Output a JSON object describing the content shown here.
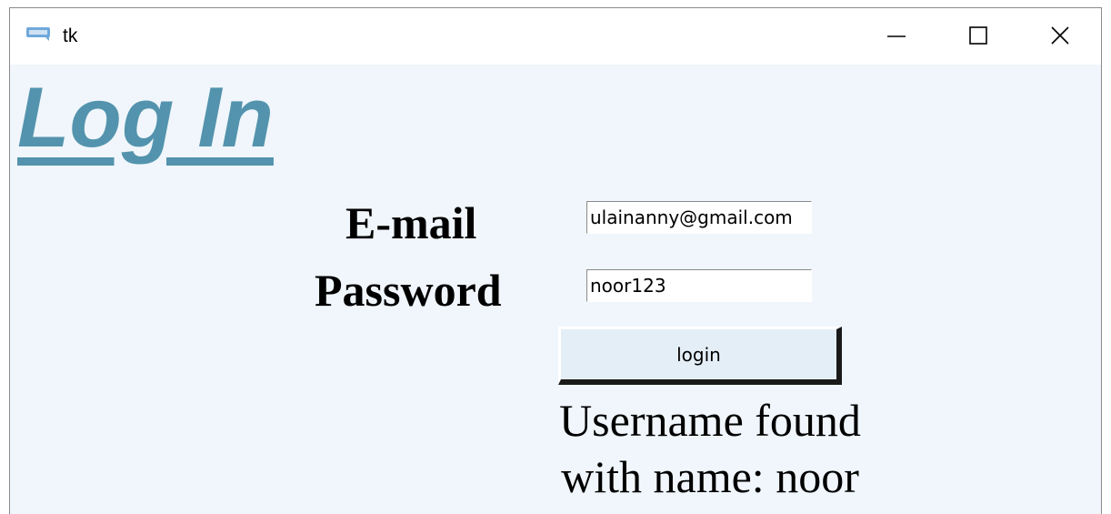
{
  "window": {
    "title": "tk",
    "icon": "login-app-icon",
    "controls": [
      "minimize-icon",
      "maximize-icon",
      "close-icon"
    ]
  },
  "heading": "Log In",
  "form": {
    "email_label": "E-mail",
    "email_value": "ulainanny@gmail.com",
    "password_label": "Password",
    "password_value": "noor123",
    "login_button": "login"
  },
  "result": {
    "line1": "Username found",
    "line2": "with name: noor"
  },
  "colors": {
    "heading": "#5393ad",
    "background": "#f0f6fb",
    "button": "#e4eef6"
  }
}
